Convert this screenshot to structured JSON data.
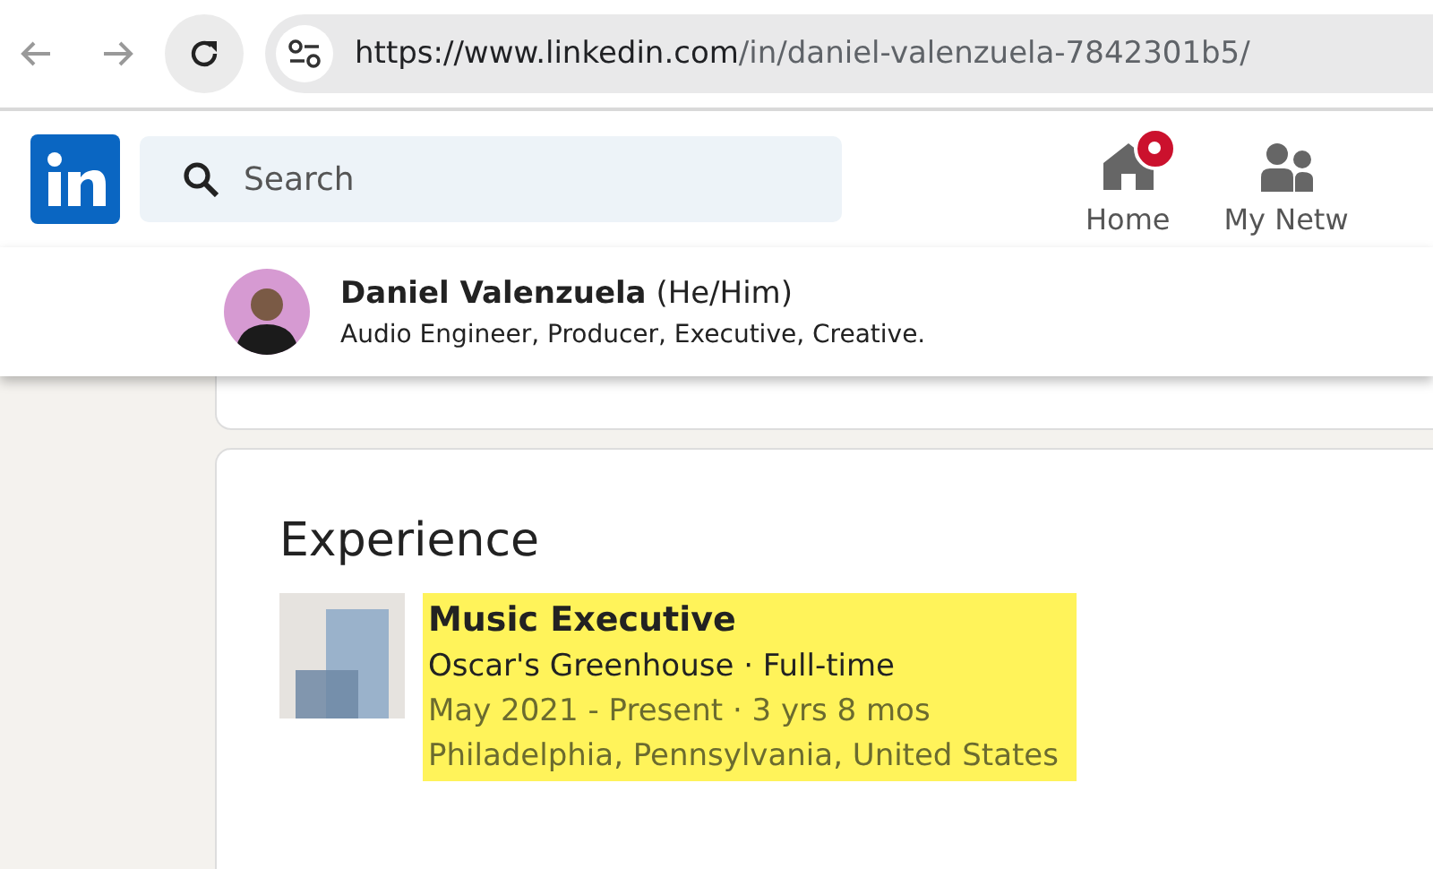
{
  "browser": {
    "url_host": "https://www.linkedin.com",
    "url_path": "/in/daniel-valenzuela-7842301b5/"
  },
  "nav": {
    "search": {
      "placeholder": "Search"
    },
    "items": [
      {
        "label": "Home",
        "kind": "home",
        "notification": true
      },
      {
        "label": "My Netw",
        "kind": "network",
        "notification": false
      }
    ]
  },
  "profile_header": {
    "name": "Daniel Valenzuela",
    "pronouns": "(He/Him)",
    "headline": "Audio Engineer, Producer, Executive, Creative."
  },
  "experience": {
    "title": "Experience",
    "items": [
      {
        "role": "Music Executive",
        "company": "Oscar's Greenhouse · Full-time",
        "dates": "May 2021 - Present · 3 yrs 8 mos",
        "location": "Philadelphia, Pennsylvania, United States",
        "highlighted": true
      }
    ]
  }
}
